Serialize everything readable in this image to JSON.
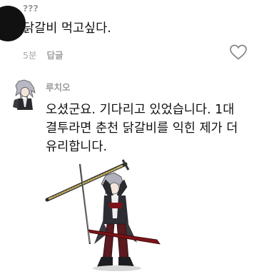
{
  "comments": [
    {
      "author": "???",
      "text": "닭갈비 먹고싶다.",
      "time": "5분",
      "reply_label": "답글"
    },
    {
      "author": "루치오",
      "lines": [
        "오셨군요. 기다리고 있었습니다. 1대",
        "결투라면 춘천 닭갈비를 익힌 제가 더",
        "유리합니다."
      ]
    }
  ],
  "colors": {
    "text": "#111111",
    "meta": "#a8a8a8",
    "author": "#9a9a9a",
    "cape": "#7a1418"
  }
}
